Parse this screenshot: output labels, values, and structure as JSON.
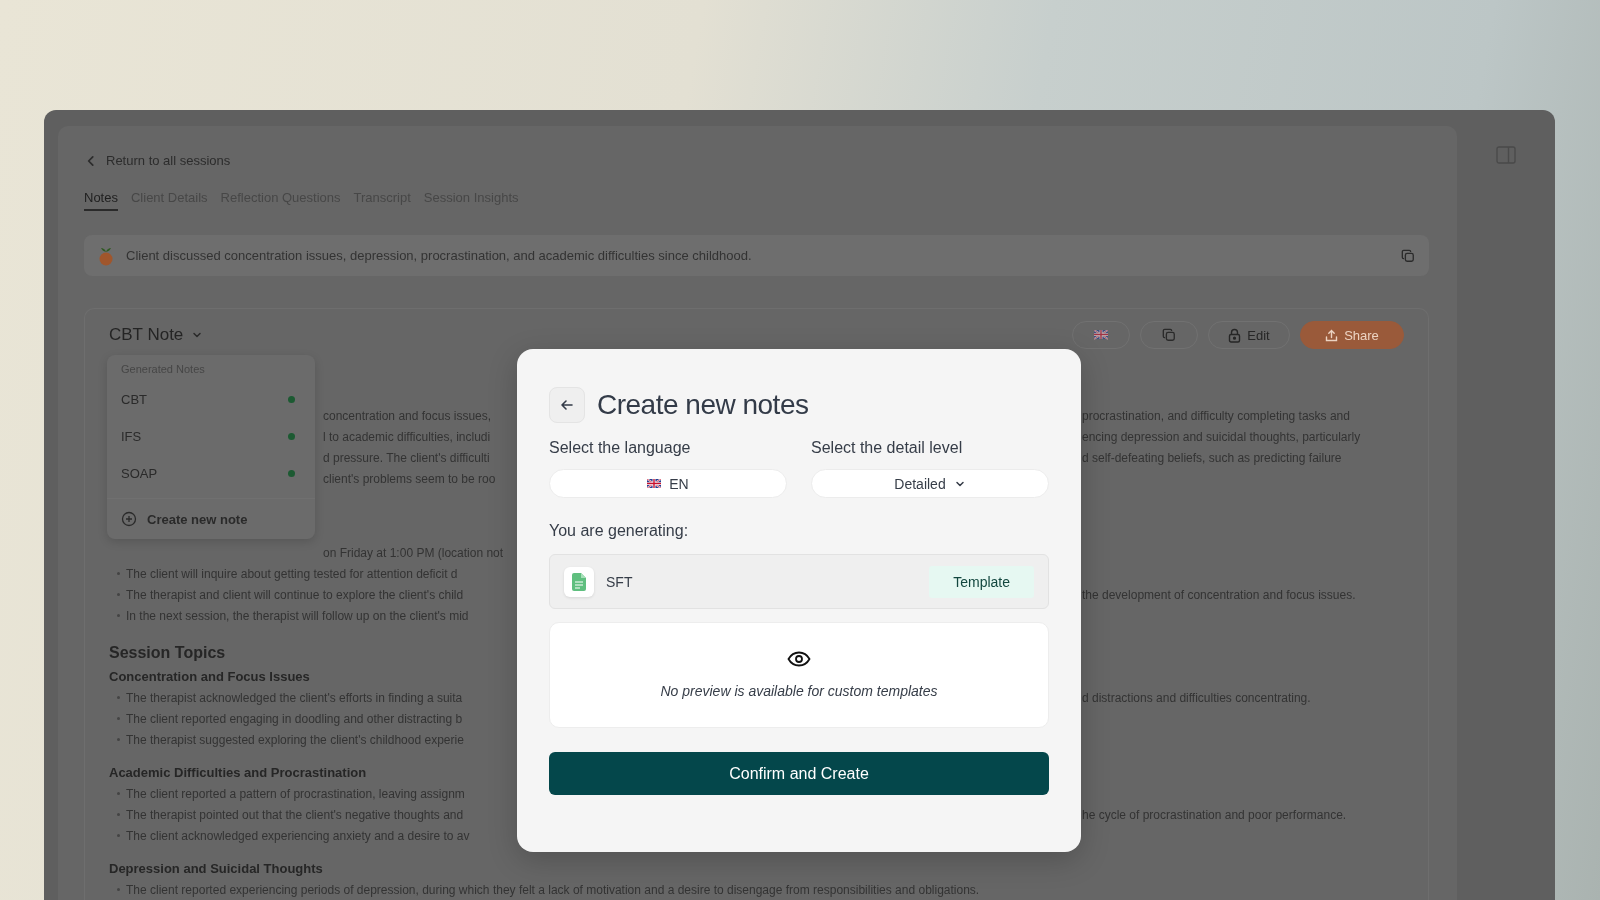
{
  "nav": {
    "back_link": "Return to all sessions"
  },
  "tabs": [
    {
      "label": "Notes",
      "selected": true
    },
    {
      "label": "Client Details",
      "selected": false
    },
    {
      "label": "Reflection Questions",
      "selected": false
    },
    {
      "label": "Transcript",
      "selected": false
    },
    {
      "label": "Session Insights",
      "selected": false
    }
  ],
  "summary": {
    "text": "Client discussed concentration issues, depression, procrastination, and academic difficulties since childhood."
  },
  "note": {
    "title": "CBT Note",
    "actions": [
      {
        "kind": "flag"
      },
      {
        "kind": "copy"
      },
      {
        "kind": "edit",
        "label": "Edit"
      },
      {
        "kind": "share",
        "label": "Share"
      }
    ],
    "menu": {
      "heading": "Generated Notes",
      "items": [
        {
          "label": "CBT"
        },
        {
          "label": "IFS"
        },
        {
          "label": "SOAP"
        }
      ],
      "create": "Create new note"
    },
    "groups": [
      {
        "rows": [
          {
            "kind": "fragment",
            "left": "concentration and focus issues,",
            "right": "procrastination, and difficulty completing tasks and"
          },
          {
            "kind": "fragment",
            "left": "l to academic difficulties, includi",
            "right": "encing depression and suicidal thoughts, particularly"
          },
          {
            "kind": "fragment",
            "left": "d pressure. The client's difficulti",
            "right": "d self-defeating beliefs, such as predicting failure"
          },
          {
            "kind": "fragment",
            "left": "client's problems seem to be roo"
          }
        ]
      },
      {
        "rows": [
          {
            "kind": "fragment",
            "left": "on Friday at 1:00 PM (location not"
          },
          {
            "kind": "bullet",
            "left": "The client will inquire about getting tested for attention deficit d"
          },
          {
            "kind": "bullet",
            "left": "The therapist and client will continue to explore the client's child",
            "right": "the development of concentration and focus issues."
          },
          {
            "kind": "bullet",
            "left": "In the next session, the therapist will follow up on the client's mid"
          }
        ]
      },
      {
        "rows": [
          {
            "kind": "heading",
            "left": "Session Topics"
          },
          {
            "kind": "subheading",
            "left": "Concentration and Focus Issues"
          },
          {
            "kind": "bullet",
            "left": "The therapist acknowledged the client's efforts in finding a suita",
            "right": "d distractions and difficulties concentrating."
          },
          {
            "kind": "bullet",
            "left": "The client reported engaging in doodling and other distracting b"
          },
          {
            "kind": "bullet",
            "left": "The therapist suggested exploring the client's childhood experie"
          }
        ]
      },
      {
        "rows": [
          {
            "kind": "subheading",
            "left": "Academic Difficulties and Procrastination"
          },
          {
            "kind": "bullet",
            "left": "The client reported a pattern of procrastination, leaving assignm"
          },
          {
            "kind": "bullet",
            "left": "The therapist pointed out that the client's negative thoughts and",
            "right": "he cycle of procrastination and poor performance."
          },
          {
            "kind": "bullet",
            "left": "The client acknowledged experiencing anxiety and a desire to av"
          }
        ]
      },
      {
        "rows": [
          {
            "kind": "subheading",
            "left": "Depression and Suicidal Thoughts"
          },
          {
            "kind": "bullet",
            "text": "The client reported experiencing periods of depression, during which they felt a lack of motivation and a desire to disengage from responsibilities and obligations."
          }
        ]
      }
    ]
  },
  "modal": {
    "title": "Create new notes",
    "language": {
      "label": "Select the language",
      "value": "EN"
    },
    "detail": {
      "label": "Select the detail level",
      "value": "Detailed"
    },
    "generating": {
      "label": "You are generating:",
      "name": "SFT",
      "tag": "Template"
    },
    "preview": {
      "text": "No preview is available for custom templates"
    },
    "confirm": "Confirm and Create"
  }
}
